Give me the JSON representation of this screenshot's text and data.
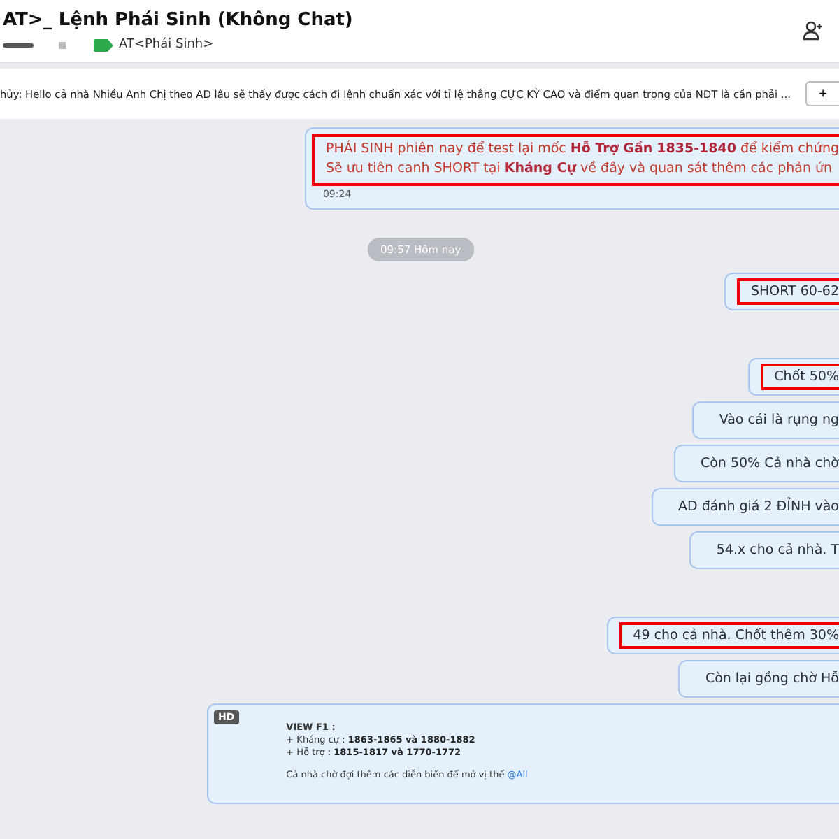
{
  "header": {
    "title": "AT>_ Lệnh Phái Sinh (Không Chat)",
    "tag": "AT<Phái Sinh>"
  },
  "pinned": {
    "text": "hủy: Hello cả nhà Nhiều Anh Chị theo AD lâu sẽ thấy được cách đi lệnh chuẩn xác với tỉ lệ thắng CỰC KỲ CAO và điểm quan trọng của NĐT là cần phải ...",
    "button": "+"
  },
  "messages": [
    {
      "kind": "alert",
      "highlighted": true,
      "lines": [
        "PHÁI SINH phiên nay để test lại mốc **Hỗ Trợ Gần** **1835-1840** để kiểm chứng",
        "Sẽ ưu tiên canh SHORT tại **Kháng Cự** về đây và quan sát thêm các phản ứn"
      ],
      "time": "09:24"
    },
    {
      "kind": "date",
      "lines": [
        "09:57 Hôm nay"
      ]
    },
    {
      "kind": "plain",
      "highlighted": true,
      "lines": [
        "SHORT 60-62"
      ],
      "gap": true
    },
    {
      "kind": "plain",
      "highlighted": true,
      "lines": [
        "Chốt 50%"
      ]
    },
    {
      "kind": "plain",
      "highlighted": false,
      "lines": [
        "Vào cái là rụng ng"
      ]
    },
    {
      "kind": "plain",
      "highlighted": false,
      "lines": [
        "Còn 50% Cả nhà chờ"
      ]
    },
    {
      "kind": "plain",
      "highlighted": false,
      "lines": [
        "AD đánh giá 2 ĐỈNH vào"
      ]
    },
    {
      "kind": "plain",
      "highlighted": false,
      "lines": [
        "54.x cho cả nhà. T"
      ],
      "gap": true
    },
    {
      "kind": "plain",
      "highlighted": true,
      "lines": [
        "49 cho cả nhà. Chốt thêm 30%"
      ]
    },
    {
      "kind": "plain",
      "highlighted": false,
      "lines": [
        "Còn lại gồng chờ Hỗ"
      ]
    }
  ],
  "card": {
    "badge": "HD",
    "heading": "VIEW F1 :",
    "lines": [
      "+ Kháng cự : **1863-1865   và 1880-1882**",
      "+ Hỗ trợ     : **1815-1817   và 1770-1772**"
    ],
    "footer": "Cả nhà chờ đợi thêm các diễn biến để mở vị thế",
    "mention": "@All"
  }
}
